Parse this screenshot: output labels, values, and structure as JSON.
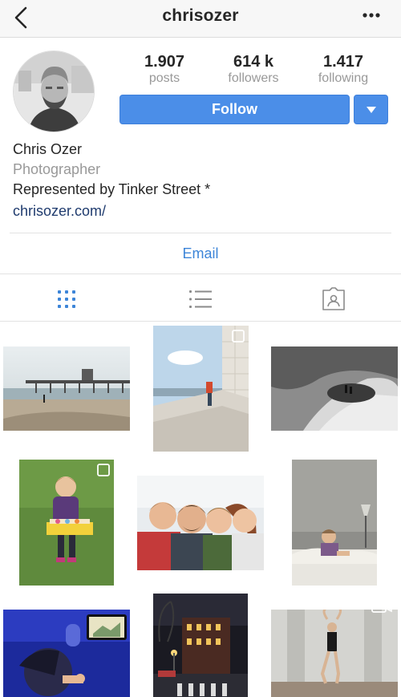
{
  "header": {
    "username": "chrisozer",
    "back_icon": "chevron-left-icon",
    "more_icon": "more-horizontal-icon"
  },
  "stats": [
    {
      "value": "1.907",
      "label": "posts"
    },
    {
      "value": "614 k",
      "label": "followers"
    },
    {
      "value": "1.417",
      "label": "following"
    }
  ],
  "actions": {
    "follow_label": "Follow",
    "dropdown_icon": "caret-down-icon",
    "accent_color": "#4b8ee8"
  },
  "bio": {
    "name": "Chris Ozer",
    "category": "Photographer",
    "text": "Represented by Tinker Street *",
    "link": "chrisozer.com/"
  },
  "contact": {
    "email_label": "Email"
  },
  "tabs": [
    {
      "name": "grid-icon",
      "active": true
    },
    {
      "name": "list-icon",
      "active": false
    },
    {
      "name": "tagged-icon",
      "active": false
    }
  ],
  "grid": {
    "photos": [
      {
        "subject": "beach-pier-photo"
      },
      {
        "subject": "building-wall-photo"
      },
      {
        "subject": "curved-architecture-photo"
      },
      {
        "subject": "child-with-box-photo"
      },
      {
        "subject": "family-selfie-photo"
      },
      {
        "subject": "child-on-bed-photo"
      },
      {
        "subject": "airplane-window-photo"
      },
      {
        "subject": "city-street-night-photo"
      },
      {
        "subject": "dancer-photo"
      }
    ]
  }
}
